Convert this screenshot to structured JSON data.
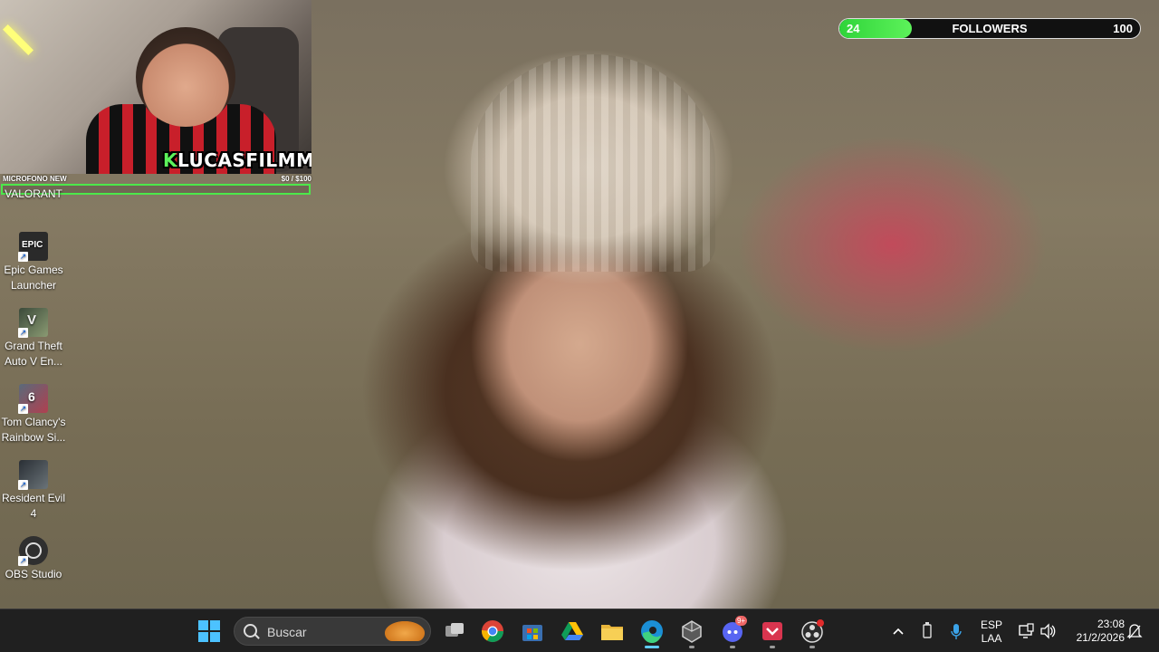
{
  "stream_overlay": {
    "webcam_name": "LUCASFILMMS",
    "webcam_name_prefix": "K",
    "donation_goal": {
      "label": "MICROFONO NEW",
      "progress": "$0  / $100",
      "fraction": 0.0
    },
    "followers_goal": {
      "current": "24",
      "label": "FOLLOWERS",
      "target": "100",
      "fraction": 0.24
    }
  },
  "desktop_icons": [
    {
      "label": "VALORANT",
      "icon": "valorant-icon"
    },
    {
      "label": "Epic Games Launcher",
      "icon": "epic-games-icon",
      "icon_text": "EPIC"
    },
    {
      "label": "Grand Theft Auto V En...",
      "icon": "gta-v-icon"
    },
    {
      "label": "Tom Clancy's Rainbow Si...",
      "icon": "rainbow-six-icon",
      "icon_text": "6"
    },
    {
      "label": "Resident Evil 4",
      "icon": "resident-evil-icon"
    },
    {
      "label": "OBS Studio",
      "icon": "obs-icon"
    }
  ],
  "taskbar": {
    "search_placeholder": "Buscar",
    "apps": [
      {
        "name": "start-icon"
      },
      {
        "name": "task-view-icon"
      },
      {
        "name": "chrome-icon"
      },
      {
        "name": "microsoft-store-icon"
      },
      {
        "name": "google-drive-icon"
      },
      {
        "name": "file-explorer-icon"
      },
      {
        "name": "edge-icon"
      },
      {
        "name": "app-cube-icon"
      },
      {
        "name": "discord-icon",
        "badge": "9+"
      },
      {
        "name": "streaming-app-icon"
      },
      {
        "name": "obs-taskbar-icon"
      }
    ],
    "tray": {
      "language_line1": "ESP",
      "language_line2": "LAA",
      "time": "23:08",
      "date": "21/2/2026"
    }
  },
  "colors": {
    "goal_green": "#4ce84a",
    "taskbar_bg": "#202020",
    "active_indicator": "#60cdff"
  }
}
